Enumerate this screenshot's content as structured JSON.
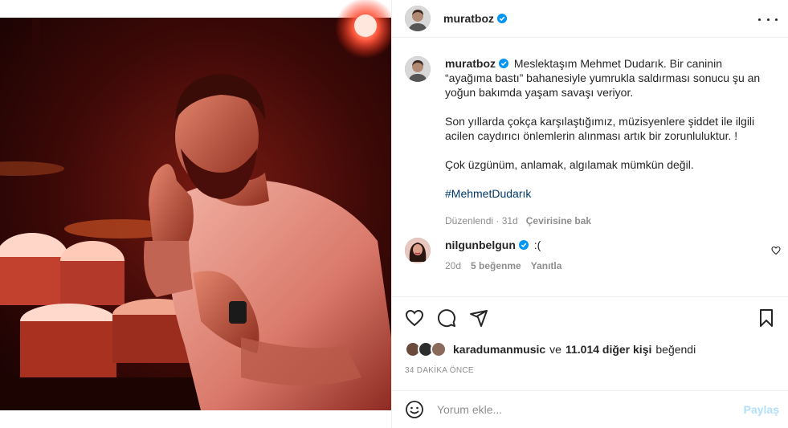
{
  "post": {
    "username": "muratboz",
    "verified": true
  },
  "caption": {
    "username": "muratboz",
    "line1": "Meslektaşım Mehmet Dudarık. Bir caninin “ayağıma bastı” bahanesiyle yumrukla saldırması sonucu şu an yoğun bakımda yaşam savaşı veriyor.",
    "line2": "Son yıllarda çokça karşılaştığımız, müzisyenlere şiddet ile ilgili acilen caydırıcı önlemlerin alınması artık bir zorunluluktur. !",
    "line3": "Çok üzgünüm, anlamak, algılamak mümkün değil.",
    "hashtag": "#MehmetDudarık",
    "edited": "Düzenlendi · 31d",
    "translate": "Çevirisine bak"
  },
  "comment": {
    "username": "nilgunbelgun",
    "text": ":(",
    "age": "20d",
    "likes": "5 beğenme",
    "reply": "Yanıtla"
  },
  "likes": {
    "user": "karadumanmusic",
    "conj": "ve",
    "others": "11.014 diğer kişi",
    "suffix": "beğendi"
  },
  "timestamp": "34 DAKİKA ÖNCE",
  "comment_box": {
    "placeholder": "Yorum ekle...",
    "share": "Paylaş"
  },
  "icons": {
    "verified_color": "#0095f6",
    "link_color": "#00376b",
    "share_disabled_color": "#b2dffc"
  }
}
